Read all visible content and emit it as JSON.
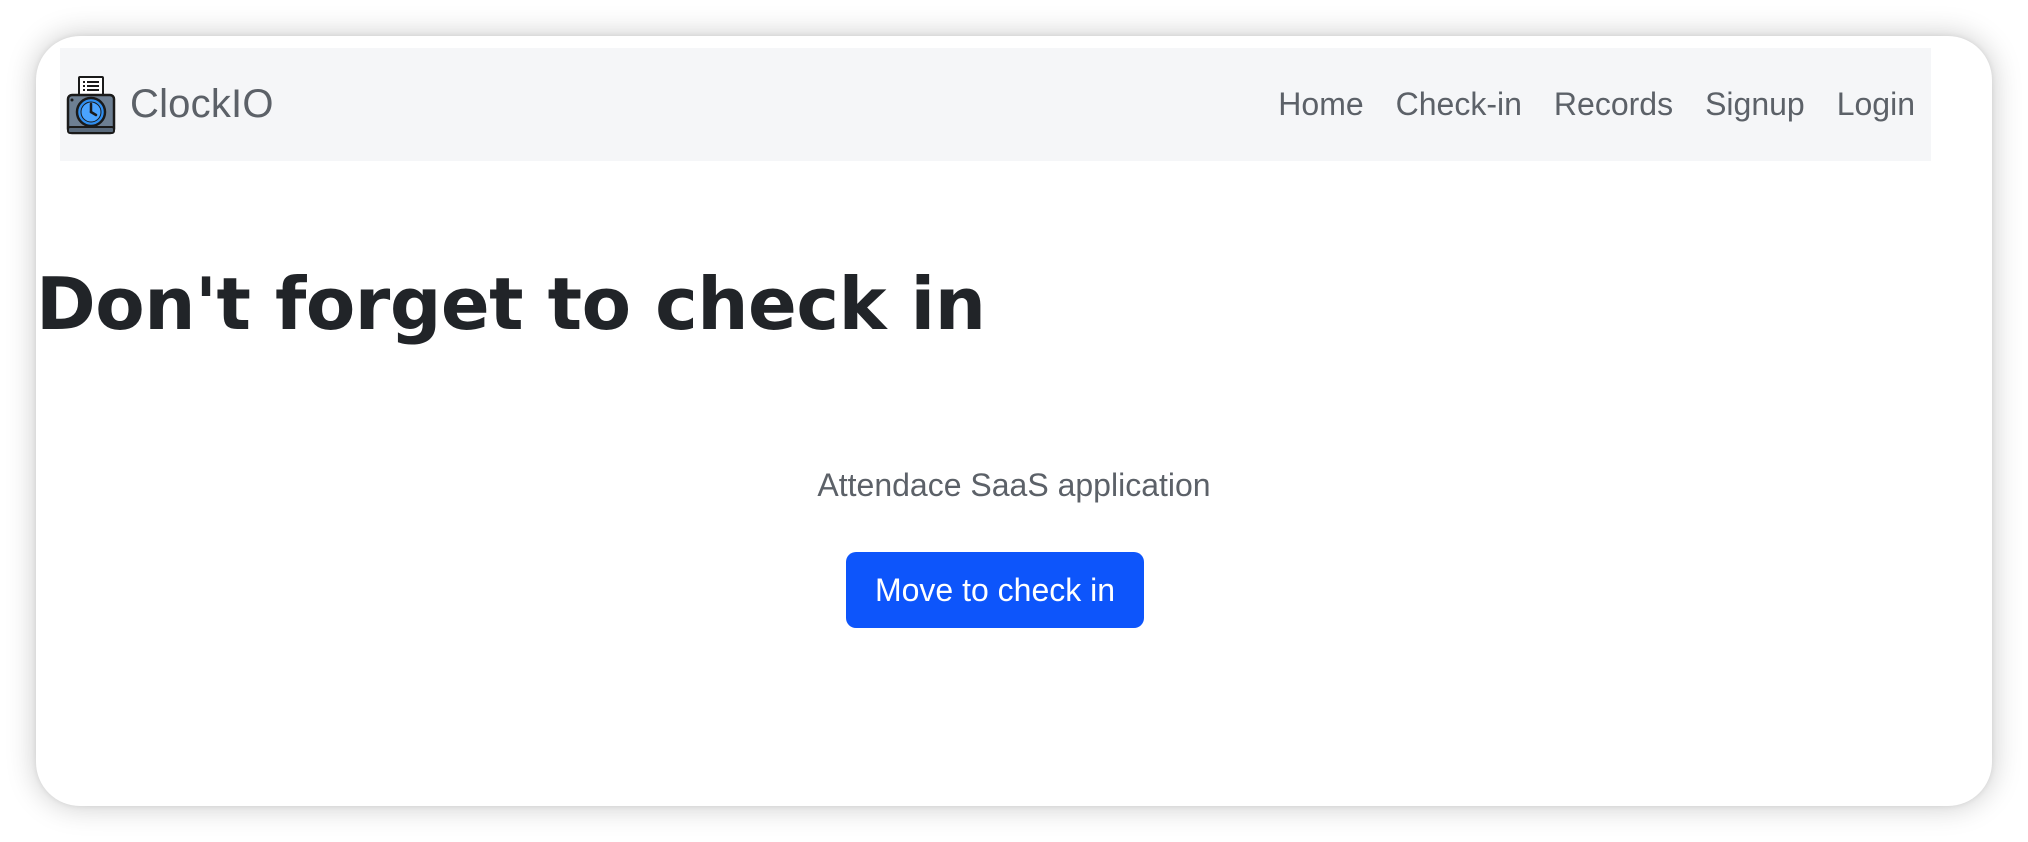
{
  "navbar": {
    "brand": {
      "name": "ClockIO",
      "icon": "time-clock-icon"
    },
    "links": [
      {
        "label": "Home"
      },
      {
        "label": "Check-in"
      },
      {
        "label": "Records"
      },
      {
        "label": "Signup"
      },
      {
        "label": "Login"
      }
    ]
  },
  "hero": {
    "title": "Don't forget to check in",
    "subtitle": "Attendace SaaS application",
    "button_label": "Move to check in"
  },
  "colors": {
    "navbar_background": "#f5f6f8",
    "primary_button": "#0d55fb",
    "title_text": "#212428",
    "muted_text": "#5c6168"
  }
}
